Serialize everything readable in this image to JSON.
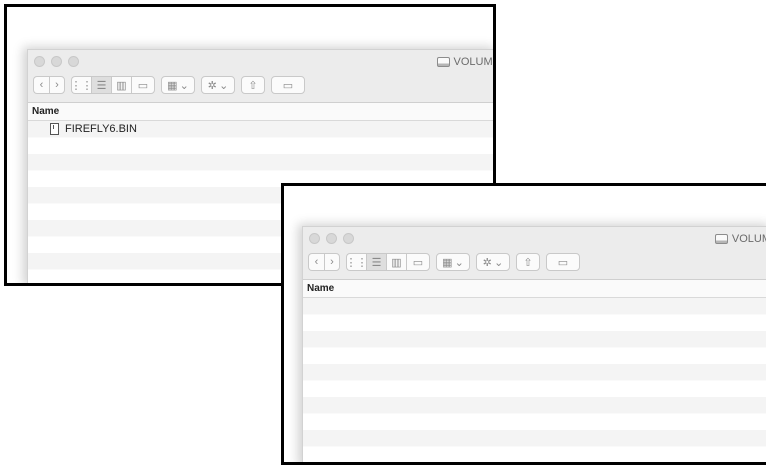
{
  "panels": [
    {
      "volume_label": "VOLUME",
      "column_header": "Name",
      "files": [
        "FIREFLY6.BIN"
      ]
    },
    {
      "volume_label": "VOLUM",
      "column_header": "Name",
      "files": []
    }
  ],
  "toolbar_icons": {
    "back": "‹",
    "forward": "›",
    "view_icon": "⋮⋮",
    "view_list": "☰",
    "view_column": "▥",
    "view_cover": "▭",
    "arrange": "▦",
    "action": "✲",
    "share": "⇧",
    "tag": "▭"
  }
}
